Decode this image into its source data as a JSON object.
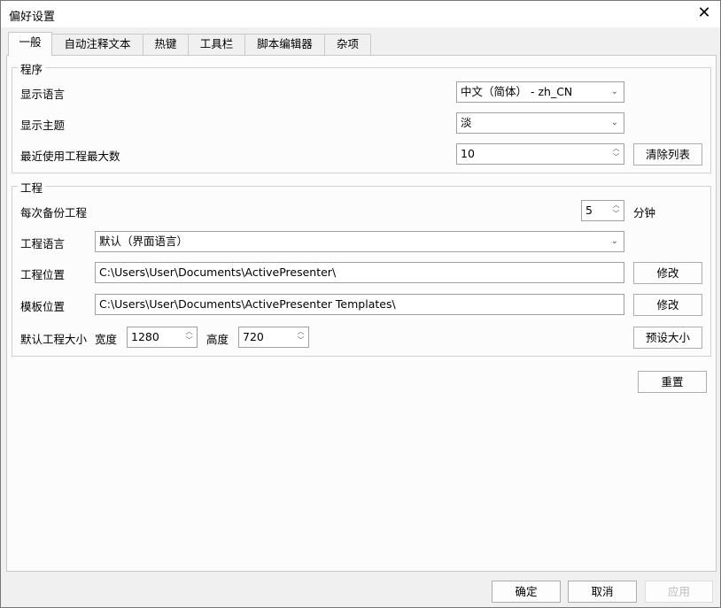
{
  "window": {
    "title": "偏好设置"
  },
  "tabs": [
    "一般",
    "自动注释文本",
    "热键",
    "工具栏",
    "脚本编辑器",
    "杂项"
  ],
  "program": {
    "group_label": "程序",
    "display_language": {
      "label": "显示语言",
      "value": "中文（简体） - zh_CN"
    },
    "display_theme": {
      "label": "显示主题",
      "value": "淡"
    },
    "recent_max": {
      "label": "最近使用工程最大数",
      "value": "10"
    },
    "clear_list": "清除列表"
  },
  "project": {
    "group_label": "工程",
    "backup": {
      "label": "每次备份工程",
      "value": "5",
      "unit": "分钟"
    },
    "language": {
      "label": "工程语言",
      "value": "默认（界面语言）"
    },
    "location": {
      "label": "工程位置",
      "value": "C:\\Users\\User\\Documents\\ActivePresenter\\",
      "button": "修改"
    },
    "template": {
      "label": "模板位置",
      "value": "C:\\Users\\User\\Documents\\ActivePresenter Templates\\",
      "button": "修改"
    },
    "size": {
      "label": "默认工程大小",
      "width_label": "宽度",
      "width": "1280",
      "height_label": "高度",
      "height": "720",
      "preset": "预设大小"
    }
  },
  "reset": "重置",
  "footer": {
    "ok": "确定",
    "cancel": "取消",
    "apply": "应用"
  }
}
